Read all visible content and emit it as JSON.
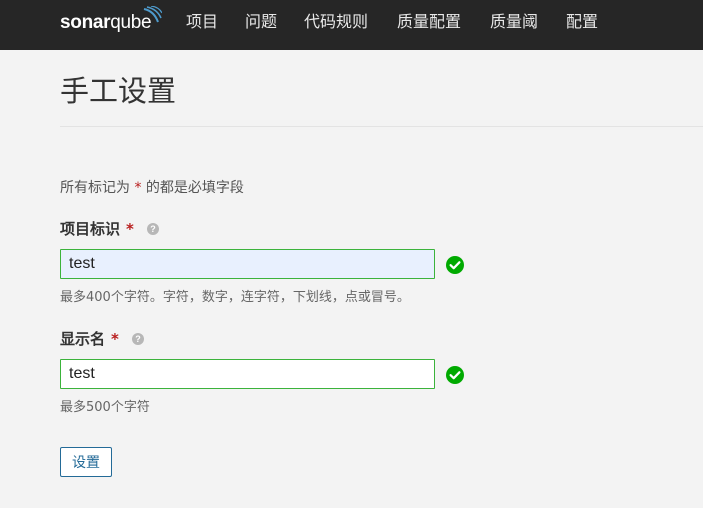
{
  "app": {
    "logo_text_bold": "sonar",
    "logo_text_light": "qube"
  },
  "nav": {
    "items": [
      {
        "label": "项目"
      },
      {
        "label": "问题"
      },
      {
        "label": "代码规则"
      },
      {
        "label": "质量配置"
      },
      {
        "label": "质量阈"
      },
      {
        "label": "配置"
      }
    ]
  },
  "page": {
    "title": "手工设置",
    "required_note_prefix": "所有标记为",
    "required_note_star": "*",
    "required_note_suffix": "的都是必填字段"
  },
  "fields": {
    "project_key": {
      "label": "项目标识",
      "required_mark": "*",
      "help_icon": "?",
      "value": "test",
      "hint": "最多400个字符。字符，数字，连字符，下划线，点或冒号。",
      "status_icon": "check-circle-icon"
    },
    "display_name": {
      "label": "显示名",
      "required_mark": "*",
      "help_icon": "?",
      "value": "test",
      "hint": "最多500个字符",
      "status_icon": "check-circle-icon"
    }
  },
  "actions": {
    "submit_label": "设置"
  },
  "colors": {
    "topbar": "#262626",
    "accent": "#236a97",
    "success": "#00aa00",
    "required": "#b81d1d",
    "logo_wave": "#4e9bcd"
  }
}
